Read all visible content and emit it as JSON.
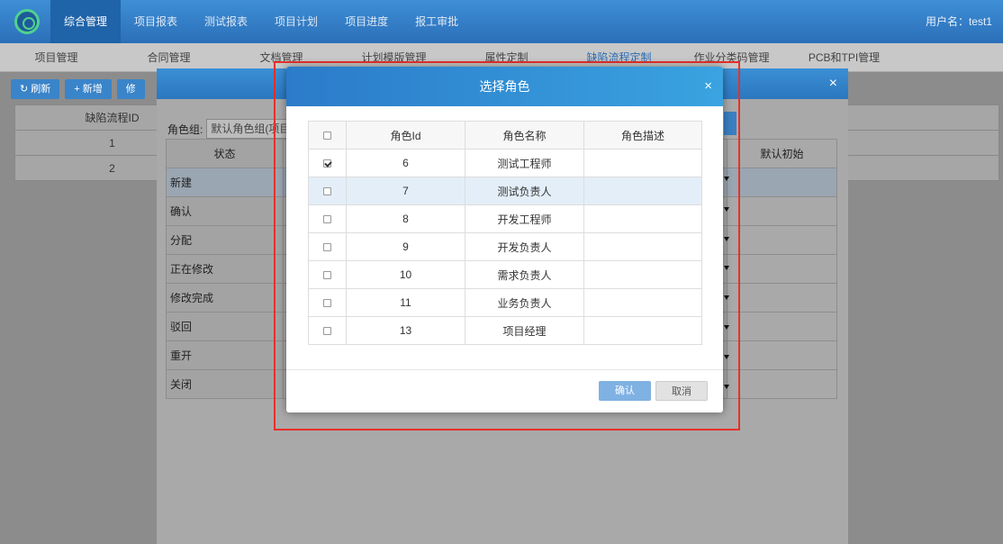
{
  "topnav": {
    "items": [
      "综合管理",
      "项目报表",
      "测试报表",
      "项目计划",
      "项目进度",
      "报工审批"
    ],
    "active_index": 0,
    "user": "用户名：test1"
  },
  "subnav": {
    "items": [
      "项目管理",
      "合同管理",
      "文档管理",
      "计划模版管理",
      "属性定制",
      "缺陷流程定制",
      "作业分类码管理",
      "PCB和TPI管理"
    ],
    "active_index": 5
  },
  "toolbar": {
    "refresh": "刷新",
    "add": "+ 新增",
    "more": "修"
  },
  "bg_table": {
    "header": "缺陷流程ID",
    "rows": [
      "1",
      "2"
    ]
  },
  "mid_dialog": {
    "role_group_label": "角色组:",
    "role_group_value": "默认角色组(项目管",
    "status_header": "状态",
    "default_header": "默认初始",
    "states": [
      "新建",
      "确认",
      "分配",
      "正在修改",
      "修改完成",
      "驳回",
      "重开",
      "关闭"
    ]
  },
  "modal": {
    "title": "选择角色",
    "close": "×",
    "columns": [
      "角色Id",
      "角色名称",
      "角色描述"
    ],
    "rows": [
      {
        "id": "6",
        "name": "测试工程师",
        "desc": "",
        "checked": true,
        "selected": false
      },
      {
        "id": "7",
        "name": "测试负责人",
        "desc": "",
        "checked": false,
        "selected": true
      },
      {
        "id": "8",
        "name": "开发工程师",
        "desc": "",
        "checked": false,
        "selected": false
      },
      {
        "id": "9",
        "name": "开发负责人",
        "desc": "",
        "checked": false,
        "selected": false
      },
      {
        "id": "10",
        "name": "需求负责人",
        "desc": "",
        "checked": false,
        "selected": false
      },
      {
        "id": "11",
        "name": "业务负责人",
        "desc": "",
        "checked": false,
        "selected": false
      },
      {
        "id": "13",
        "name": "项目经理",
        "desc": "",
        "checked": false,
        "selected": false
      }
    ],
    "ok": "确认",
    "cancel": "取消"
  },
  "colors": {
    "accent": "#2b7bc9",
    "highlight": "#e8302a"
  }
}
